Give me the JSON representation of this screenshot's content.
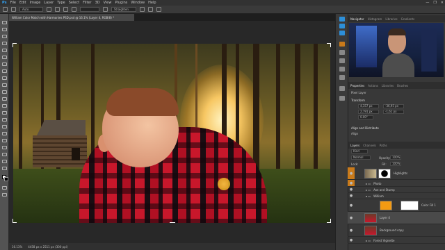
{
  "menu": [
    "File",
    "Edit",
    "Image",
    "Layer",
    "Type",
    "Select",
    "Filter",
    "3D",
    "View",
    "Plugins",
    "Window",
    "Help"
  ],
  "window_controls": [
    "—",
    "❐",
    "✕"
  ],
  "options": {
    "mode": "Auto",
    "stroke": "Straighten"
  },
  "doc_tab": "William Color Match with Harmonies PSD.psd @ 16.1% (Layer 4, RGB/8) *",
  "status": {
    "zoom": "16.13%",
    "info": "4458 px x 2511 px (300 ppi)"
  },
  "panels": {
    "tabs_top": [
      "Navigator",
      "Histogram",
      "Libraries",
      "Gradients"
    ],
    "tabs_props": [
      "Properties",
      "Actions",
      "Libraries",
      "Brushes"
    ],
    "props_title": "Pixel Layer",
    "transform_label": "Transform",
    "transform": {
      "w": "4,357 px",
      "h": "2,791 px",
      "x": "-36,95 px",
      "y": "-1,61 px",
      "angle": "0.00°"
    },
    "align_label": "Align and Distribute",
    "align_sub": "Align",
    "layers_tabs": [
      "Layers",
      "Channels",
      "Paths"
    ],
    "kind": "Kind",
    "blend": "Normal",
    "opacity_label": "Opacity:",
    "opacity": "100%",
    "lock_label": "Lock:",
    "fill_label": "Fill:",
    "fill": "100%",
    "layers": [
      {
        "name": "Highlights",
        "type": "thumb"
      },
      {
        "name": "Photo",
        "type": "group"
      },
      {
        "name": "Axe and Stump",
        "type": "group"
      },
      {
        "name": "William",
        "type": "group"
      },
      {
        "name": "Color Fill 1",
        "type": "fill"
      },
      {
        "name": "Layer 4",
        "type": "sel"
      },
      {
        "name": "Background copy",
        "type": "thumb"
      },
      {
        "name": "Forest Vignette",
        "type": "group"
      }
    ]
  },
  "colors": {
    "accent": "#c97a1a",
    "shirt": "#c8172b",
    "sky": "#1c2b56"
  },
  "icons": [
    "move-icon",
    "marquee-icon",
    "lasso-icon",
    "crop-icon",
    "eyedropper-icon",
    "brush-icon",
    "eraser-icon",
    "gradient-icon",
    "pen-icon",
    "type-icon",
    "hand-icon",
    "zoom-icon",
    "eye-icon",
    "lock-icon"
  ]
}
